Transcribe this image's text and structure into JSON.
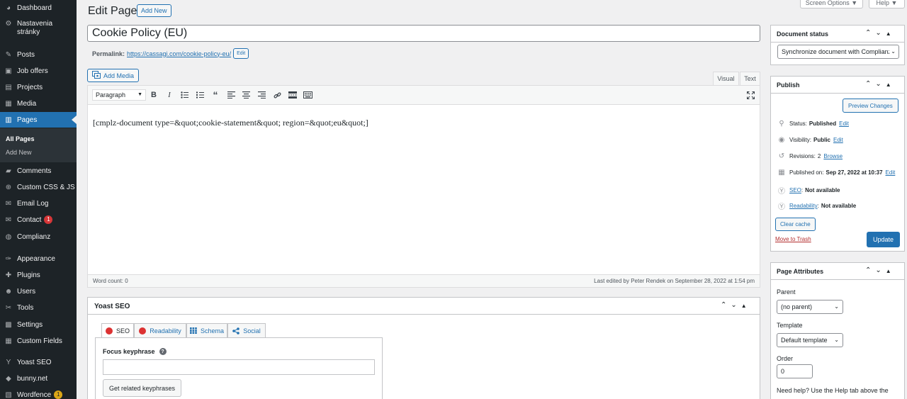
{
  "sidebar": {
    "items": [
      {
        "label": "Dashboard",
        "icon": "dashboard-icon",
        "glyph": "◕"
      },
      {
        "label": "Nastavenia stránky",
        "icon": "gear-icon",
        "glyph": "⚙"
      },
      {
        "label": "Posts",
        "icon": "pin-icon",
        "glyph": "✎"
      },
      {
        "label": "Job offers",
        "icon": "briefcase-icon",
        "glyph": "▣"
      },
      {
        "label": "Projects",
        "icon": "portfolio-icon",
        "glyph": "▤"
      },
      {
        "label": "Media",
        "icon": "media-icon",
        "glyph": "▦"
      },
      {
        "label": "Pages",
        "icon": "page-icon",
        "glyph": "▥"
      },
      {
        "label": "Comments",
        "icon": "comment-icon",
        "glyph": "▰"
      },
      {
        "label": "Custom CSS & JS",
        "icon": "plus-circle-icon",
        "glyph": "⊕"
      },
      {
        "label": "Email Log",
        "icon": "email-icon",
        "glyph": "✉"
      },
      {
        "label": "Contact",
        "icon": "email-icon",
        "glyph": "✉",
        "badge": "1"
      },
      {
        "label": "Complianz",
        "icon": "shield-icon",
        "glyph": "◍"
      },
      {
        "label": "Appearance",
        "icon": "brush-icon",
        "glyph": "✑"
      },
      {
        "label": "Plugins",
        "icon": "plug-icon",
        "glyph": "✚"
      },
      {
        "label": "Users",
        "icon": "users-icon",
        "glyph": "☻"
      },
      {
        "label": "Tools",
        "icon": "wrench-icon",
        "glyph": "✂"
      },
      {
        "label": "Settings",
        "icon": "sliders-icon",
        "glyph": "▩"
      },
      {
        "label": "Custom Fields",
        "icon": "grid-icon",
        "glyph": "▦"
      },
      {
        "label": "Yoast SEO",
        "icon": "yoast-icon",
        "glyph": "Y"
      },
      {
        "label": "bunny.net",
        "icon": "bunny-icon",
        "glyph": "◆"
      },
      {
        "label": "Wordfence",
        "icon": "wordfence-icon",
        "glyph": "▧",
        "badge": "1"
      }
    ],
    "submenu": [
      "All Pages",
      "Add New"
    ]
  },
  "top": {
    "screen_options": "Screen Options ▼",
    "help": "Help ▼"
  },
  "main": {
    "title": "Edit Page",
    "add_new": "Add New",
    "post_title": "Cookie Policy (EU)",
    "permalink_label": "Permalink:",
    "permalink_url": "https://cassagi.com/cookie-policy-eu/",
    "permalink_edit": "Edit",
    "add_media": "Add Media",
    "tab_visual": "Visual",
    "tab_text": "Text",
    "format": "Paragraph",
    "content": "[cmplz-document type=&quot;cookie-statement&quot; region=&quot;eu&quot;]",
    "word_count": "Word count: 0",
    "last_edited": "Last edited by Peter Rendek on September 28, 2022 at 1:54 pm"
  },
  "yoast": {
    "title": "Yoast SEO",
    "tabs": [
      "SEO",
      "Readability",
      "Schema",
      "Social"
    ],
    "focus_label": "Focus keyphrase",
    "related_btn": "Get related keyphrases"
  },
  "document_status": {
    "title": "Document status",
    "select_value": "Synchronize document with Complianz"
  },
  "publish": {
    "title": "Publish",
    "preview": "Preview Changes",
    "status_label": "Status:",
    "status_value": "Published",
    "visibility_label": "Visibility:",
    "visibility_value": "Public",
    "revisions_label": "Revisions:",
    "revisions_value": "2",
    "browse": "Browse",
    "published_label": "Published on:",
    "published_value": "Sep 27, 2022 at 10:37",
    "edit": "Edit",
    "seo_link": "SEO",
    "seo_value": "Not available",
    "readability_link": "Readability",
    "readability_value": "Not available",
    "clear_cache": "Clear cache",
    "move_trash": "Move to Trash",
    "update": "Update"
  },
  "attributes": {
    "title": "Page Attributes",
    "parent_label": "Parent",
    "parent_value": "(no parent)",
    "template_label": "Template",
    "template_value": "Default template",
    "order_label": "Order",
    "order_value": "0",
    "help": "Need help? Use the Help tab above the"
  },
  "colors": {
    "accent": "#2271b1",
    "sidebar": "#1d2327",
    "danger": "#d63638"
  }
}
